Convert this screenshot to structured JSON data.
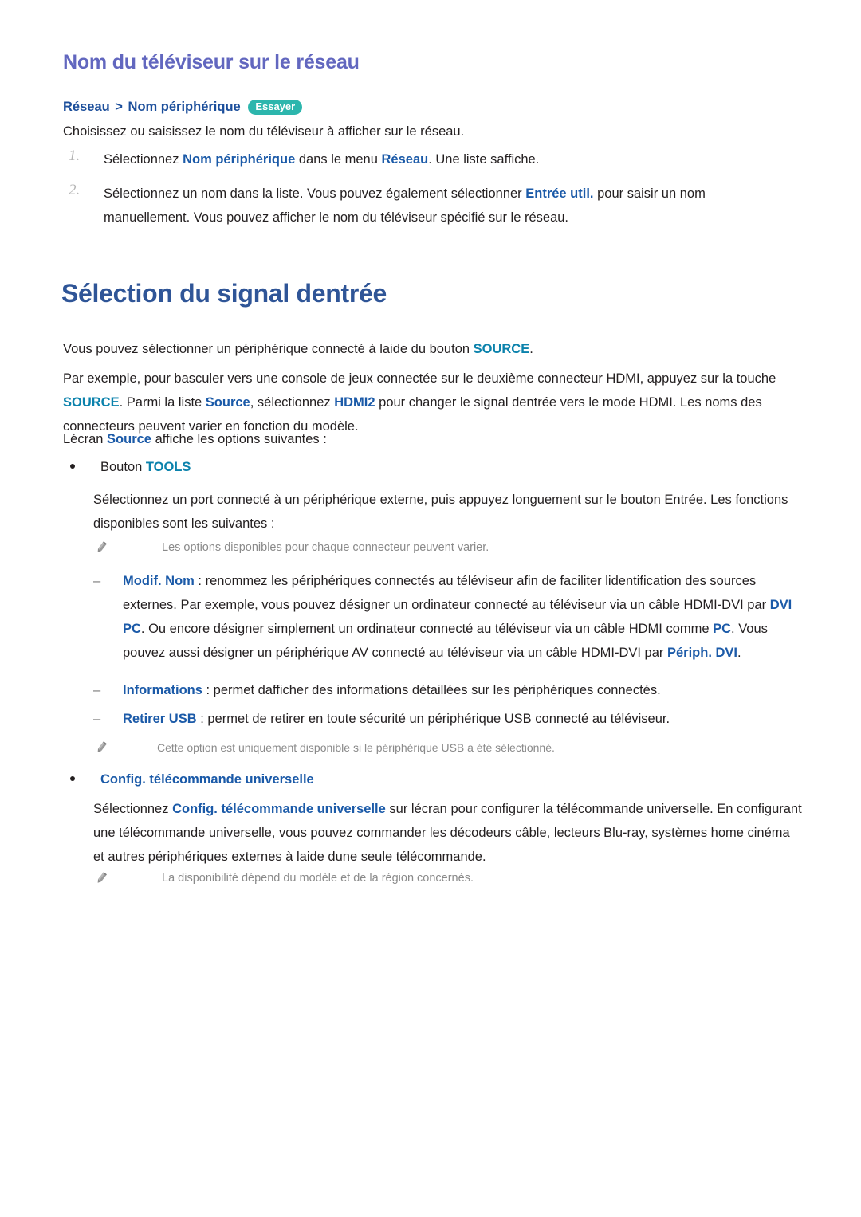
{
  "document": {
    "section_heading": "Nom du téléviseur sur le réseau",
    "main_heading": "Sélection du signal dentrée"
  },
  "breadcrumb": {
    "root": "Réseau",
    "separator": ">",
    "leaf": "Nom périphérique",
    "badge_label": "Essayer",
    "badge_color": "#2cb6ad"
  },
  "colors": {
    "section_heading": "#6267bf",
    "main_heading": "#2f5597",
    "keyword_teal": "#0b82ac",
    "keyword_blue": "#1b5aa8",
    "body_text": "#231f20",
    "note_text": "#8a8a8a",
    "list_marker": "#b5b5b5"
  },
  "network_name_section": {
    "intro": "Choisissez ou saisissez le nom du téléviseur à afficher sur le réseau.",
    "steps": [
      {
        "marker": "1.",
        "parts": [
          {
            "text": "Sélectionnez ",
            "style": "plain"
          },
          {
            "text": "Nom périphérique",
            "style": "blue"
          },
          {
            "text": " dans le menu ",
            "style": "plain"
          },
          {
            "text": "Réseau",
            "style": "blue"
          },
          {
            "text": ". Une liste saffiche.",
            "style": "plain"
          }
        ]
      },
      {
        "marker": "2.",
        "parts": [
          {
            "text": "Sélectionnez un nom dans la liste. Vous pouvez également sélectionner ",
            "style": "plain"
          },
          {
            "text": "Entrée util.",
            "style": "blue"
          },
          {
            "text": " pour saisir un nom manuellement. Vous pouvez afficher le nom du téléviseur spécifié sur le réseau.",
            "style": "plain"
          }
        ]
      }
    ]
  },
  "input_signal_section": {
    "paragraph_1": [
      {
        "text": "Vous pouvez sélectionner un périphérique connecté à laide du bouton ",
        "style": "plain"
      },
      {
        "text": "SOURCE",
        "style": "teal"
      },
      {
        "text": ".",
        "style": "plain"
      }
    ],
    "paragraph_2": [
      {
        "text": "Par exemple, pour basculer vers une console de jeux connectée sur le deuxième connecteur HDMI, appuyez sur la touche ",
        "style": "plain"
      },
      {
        "text": "SOURCE",
        "style": "teal"
      },
      {
        "text": ". Parmi la liste ",
        "style": "plain"
      },
      {
        "text": "Source",
        "style": "blue"
      },
      {
        "text": ", sélectionnez ",
        "style": "plain"
      },
      {
        "text": "HDMI2",
        "style": "blue"
      },
      {
        "text": " pour changer le signal dentrée vers le mode HDMI. Les noms des connecteurs peuvent varier en fonction du modèle.",
        "style": "plain"
      }
    ],
    "paragraph_3": [
      {
        "text": "Lécran ",
        "style": "plain"
      },
      {
        "text": "Source",
        "style": "blue"
      },
      {
        "text": " affiche les options suivantes :",
        "style": "plain"
      }
    ],
    "bullet_tools": [
      {
        "text": "Bouton ",
        "style": "plain"
      },
      {
        "text": "TOOLS",
        "style": "teal"
      }
    ],
    "tools_description": "Sélectionnez un port connecté à un périphérique externe, puis appuyez longuement sur le bouton Entrée. Les fonctions disponibles sont les suivantes :",
    "note_connectors": {
      "icon": "pencil-icon",
      "text": "Les options disponibles pour chaque connecteur peuvent varier."
    },
    "sub_items": [
      {
        "marker": "–",
        "parts": [
          {
            "text": "Modif. Nom",
            "style": "blue"
          },
          {
            "text": " : renommez les périphériques connectés au téléviseur afin de faciliter lidentification des sources externes. Par exemple, vous pouvez désigner un ordinateur connecté au téléviseur via un câble HDMI-DVI par ",
            "style": "plain"
          },
          {
            "text": "DVI PC",
            "style": "blue"
          },
          {
            "text": ". Ou encore désigner simplement un ordinateur connecté au téléviseur via un câble HDMI comme ",
            "style": "plain"
          },
          {
            "text": "PC",
            "style": "blue"
          },
          {
            "text": ". Vous pouvez aussi désigner un périphérique AV connecté au téléviseur via un câble HDMI-DVI par ",
            "style": "plain"
          },
          {
            "text": "Périph. DVI",
            "style": "blue"
          },
          {
            "text": ".",
            "style": "plain"
          }
        ]
      },
      {
        "marker": "–",
        "parts": [
          {
            "text": "Informations",
            "style": "blue"
          },
          {
            "text": " : permet dafficher des informations détaillées sur les périphériques connectés.",
            "style": "plain"
          }
        ]
      },
      {
        "marker": "–",
        "parts": [
          {
            "text": "Retirer USB",
            "style": "blue"
          },
          {
            "text": " : permet de retirer en toute sécurité un périphérique USB connecté au téléviseur.",
            "style": "plain"
          }
        ]
      }
    ],
    "note_usb": {
      "icon": "pencil-icon",
      "text": "Cette option est uniquement disponible si le périphérique USB a été sélectionné."
    },
    "bullet_universal_remote": [
      {
        "text": "Config. télécommande universelle",
        "style": "blue"
      }
    ],
    "universal_remote_description": [
      {
        "text": "Sélectionnez ",
        "style": "plain"
      },
      {
        "text": "Config. télécommande universelle",
        "style": "blue"
      },
      {
        "text": " sur lécran pour configurer la télécommande universelle. En configurant une télécommande universelle, vous pouvez commander les décodeurs câble, lecteurs Blu-ray, systèmes home cinéma et autres périphériques externes à laide dune seule télécommande.",
        "style": "plain"
      }
    ],
    "note_availability": {
      "icon": "pencil-icon",
      "text": "La disponibilité dépend du modèle et de la région concernés."
    }
  }
}
